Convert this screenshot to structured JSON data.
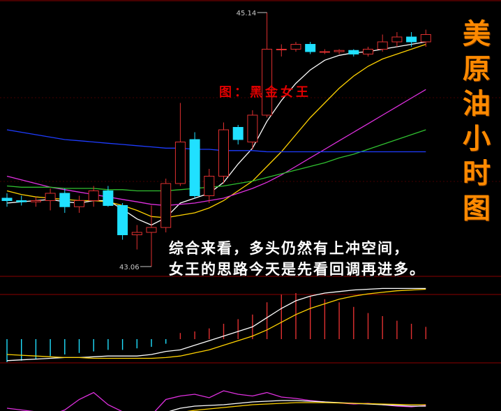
{
  "side_title_chars": [
    "美",
    "原",
    "油",
    "小",
    "时",
    "图"
  ],
  "caption": "图：黑金女王",
  "comment": {
    "line1": "综合来看，多头仍然有上冲空间，",
    "line2": "女王的思路今天是先看回调再进多。"
  },
  "colors": {
    "background": "#000000",
    "up_candle": "#e03030",
    "down_candle": "#20e0ff",
    "ma_white": "#ffffff",
    "ma_yellow": "#ffd200",
    "ma_magenta": "#e030e0",
    "ma_green": "#30c030",
    "ma_blue": "#1e3cff",
    "grid": "#8b0000",
    "title_orange": "#ff8a00"
  },
  "chart_data": [
    {
      "type": "candlestick",
      "panel": "main",
      "high_label": "45.14",
      "low_label": "43.06",
      "candles": [
        {
          "o": 43.62,
          "h": 43.66,
          "l": 43.55,
          "c": 43.6
        },
        {
          "o": 43.6,
          "h": 43.64,
          "l": 43.56,
          "c": 43.59
        },
        {
          "o": 43.59,
          "h": 43.63,
          "l": 43.55,
          "c": 43.6
        },
        {
          "o": 43.6,
          "h": 43.7,
          "l": 43.52,
          "c": 43.66
        },
        {
          "o": 43.66,
          "h": 43.7,
          "l": 43.5,
          "c": 43.55
        },
        {
          "o": 43.55,
          "h": 43.64,
          "l": 43.5,
          "c": 43.6
        },
        {
          "o": 43.6,
          "h": 43.72,
          "l": 43.55,
          "c": 43.68
        },
        {
          "o": 43.68,
          "h": 43.72,
          "l": 43.55,
          "c": 43.56
        },
        {
          "o": 43.56,
          "h": 43.58,
          "l": 43.28,
          "c": 43.32
        },
        {
          "o": 43.32,
          "h": 43.4,
          "l": 43.2,
          "c": 43.34
        },
        {
          "o": 43.34,
          "h": 43.56,
          "l": 43.06,
          "c": 43.38
        },
        {
          "o": 43.38,
          "h": 43.78,
          "l": 43.34,
          "c": 43.74
        },
        {
          "o": 43.74,
          "h": 44.4,
          "l": 43.72,
          "c": 44.08
        },
        {
          "o": 44.1,
          "h": 44.16,
          "l": 43.62,
          "c": 43.64
        },
        {
          "o": 43.64,
          "h": 43.86,
          "l": 43.58,
          "c": 43.8
        },
        {
          "o": 43.8,
          "h": 44.24,
          "l": 43.74,
          "c": 44.18
        },
        {
          "o": 44.2,
          "h": 44.22,
          "l": 44.06,
          "c": 44.1
        },
        {
          "o": 44.08,
          "h": 44.34,
          "l": 44.02,
          "c": 44.3
        },
        {
          "o": 44.3,
          "h": 45.14,
          "l": 44.28,
          "c": 44.84
        },
        {
          "o": 44.84,
          "h": 44.88,
          "l": 44.78,
          "c": 44.84
        },
        {
          "o": 44.84,
          "h": 44.9,
          "l": 44.82,
          "c": 44.88
        },
        {
          "o": 44.88,
          "h": 44.9,
          "l": 44.8,
          "c": 44.82
        },
        {
          "o": 44.82,
          "h": 44.84,
          "l": 44.8,
          "c": 44.82
        },
        {
          "o": 44.82,
          "h": 44.84,
          "l": 44.8,
          "c": 44.83
        },
        {
          "o": 44.83,
          "h": 44.84,
          "l": 44.78,
          "c": 44.8
        },
        {
          "o": 44.8,
          "h": 44.86,
          "l": 44.78,
          "c": 44.84
        },
        {
          "o": 44.84,
          "h": 44.96,
          "l": 44.82,
          "c": 44.9
        },
        {
          "o": 44.9,
          "h": 44.98,
          "l": 44.86,
          "c": 44.94
        },
        {
          "o": 44.94,
          "h": 44.98,
          "l": 44.86,
          "c": 44.9
        },
        {
          "o": 44.9,
          "h": 45.0,
          "l": 44.86,
          "c": 44.96
        }
      ],
      "moving_averages": [
        {
          "color_key": "ma_white",
          "values": [
            43.58,
            43.59,
            43.6,
            43.61,
            43.59,
            43.58,
            43.6,
            43.6,
            43.53,
            43.45,
            43.4,
            43.46,
            43.58,
            43.62,
            43.66,
            43.75,
            43.9,
            44.03,
            44.25,
            44.42,
            44.56,
            44.67,
            44.75,
            44.79,
            44.81,
            44.82,
            44.84,
            44.86,
            44.88,
            44.9
          ]
        },
        {
          "color_key": "ma_yellow",
          "values": [
            43.68,
            43.65,
            43.63,
            43.62,
            43.61,
            43.6,
            43.6,
            43.59,
            43.56,
            43.52,
            43.47,
            43.46,
            43.48,
            43.5,
            43.54,
            43.6,
            43.68,
            43.76,
            43.88,
            44.0,
            44.14,
            44.28,
            44.4,
            44.52,
            44.62,
            44.7,
            44.76,
            44.8,
            44.84,
            44.88
          ]
        },
        {
          "color_key": "ma_magenta",
          "values": [
            43.8,
            43.77,
            43.74,
            43.71,
            43.69,
            43.67,
            43.65,
            43.63,
            43.61,
            43.59,
            43.57,
            43.56,
            43.57,
            43.58,
            43.6,
            43.62,
            43.66,
            43.7,
            43.75,
            43.81,
            43.88,
            43.95,
            44.02,
            44.09,
            44.16,
            44.23,
            44.3,
            44.37,
            44.44,
            44.51
          ]
        },
        {
          "color_key": "ma_green",
          "values": [
            43.72,
            43.71,
            43.71,
            43.71,
            43.7,
            43.7,
            43.7,
            43.69,
            43.69,
            43.68,
            43.68,
            43.68,
            43.69,
            43.7,
            43.71,
            43.72,
            43.74,
            43.76,
            43.79,
            43.82,
            43.85,
            43.88,
            43.91,
            43.95,
            43.98,
            44.02,
            44.06,
            44.1,
            44.14,
            44.18
          ]
        },
        {
          "color_key": "ma_blue",
          "values": [
            44.18,
            44.16,
            44.14,
            44.12,
            44.1,
            44.09,
            44.08,
            44.07,
            44.06,
            44.05,
            44.04,
            44.03,
            44.03,
            44.02,
            44.02,
            44.01,
            44.01,
            44.01,
            44.0,
            44.0,
            44.0,
            44.0,
            44.0,
            44.0,
            44.0,
            44.0,
            44.0,
            44.0,
            44.0,
            44.0
          ]
        }
      ]
    },
    {
      "type": "bar",
      "panel": "indicator-1",
      "bars": [
        -0.3,
        -0.28,
        -0.26,
        -0.22,
        -0.2,
        -0.18,
        -0.16,
        -0.14,
        -0.14,
        -0.12,
        -0.1,
        -0.06,
        0.08,
        0.1,
        0.14,
        0.2,
        0.26,
        0.32,
        0.48,
        0.58,
        0.6,
        0.56,
        0.52,
        0.48,
        0.42,
        0.34,
        0.3,
        0.24,
        0.2,
        0.16
      ],
      "lines": [
        {
          "color_key": "ma_white",
          "values": [
            -0.28,
            -0.27,
            -0.26,
            -0.25,
            -0.24,
            -0.24,
            -0.23,
            -0.22,
            -0.22,
            -0.22,
            -0.2,
            -0.16,
            -0.14,
            -0.08,
            -0.02,
            0.04,
            0.1,
            0.16,
            0.28,
            0.4,
            0.5,
            0.56,
            0.6,
            0.62,
            0.64,
            0.65,
            0.66,
            0.66,
            0.66,
            0.66
          ]
        },
        {
          "color_key": "ma_yellow",
          "values": [
            -0.2,
            -0.21,
            -0.22,
            -0.23,
            -0.24,
            -0.24,
            -0.25,
            -0.25,
            -0.25,
            -0.25,
            -0.25,
            -0.24,
            -0.22,
            -0.18,
            -0.14,
            -0.08,
            -0.02,
            0.04,
            0.12,
            0.22,
            0.32,
            0.4,
            0.46,
            0.52,
            0.56,
            0.59,
            0.61,
            0.63,
            0.64,
            0.65
          ]
        }
      ]
    },
    {
      "type": "line",
      "panel": "indicator-2",
      "lines": [
        {
          "color_key": "ma_magenta",
          "values": [
            0.3,
            0.25,
            0.2,
            0.1,
            0.25,
            0.55,
            0.75,
            0.4,
            0.2,
            0.15,
            0.1,
            0.55,
            0.65,
            0.7,
            0.6,
            0.8,
            0.7,
            0.65,
            0.75,
            0.62,
            0.58,
            0.52,
            0.48,
            0.45,
            0.42,
            0.44,
            0.4,
            0.36,
            0.34,
            0.38
          ]
        },
        {
          "color_key": "ma_white",
          "values": [
            0.05,
            0.05,
            0.06,
            0.06,
            0.08,
            0.1,
            0.12,
            0.12,
            0.12,
            0.12,
            0.12,
            0.18,
            0.3,
            0.36,
            0.38,
            0.4,
            0.44,
            0.48,
            0.5,
            0.52,
            0.52,
            0.5,
            0.48,
            0.46,
            0.44,
            0.42,
            0.4,
            0.38,
            0.36,
            0.36
          ]
        },
        {
          "color_key": "ma_yellow",
          "values": [
            0.02,
            0.02,
            0.03,
            0.04,
            0.05,
            0.06,
            0.08,
            0.09,
            0.1,
            0.1,
            0.1,
            0.12,
            0.18,
            0.24,
            0.28,
            0.32,
            0.36,
            0.4,
            0.42,
            0.44,
            0.46,
            0.46,
            0.46,
            0.45,
            0.44,
            0.43,
            0.42,
            0.41,
            0.4,
            0.4
          ]
        }
      ]
    }
  ]
}
